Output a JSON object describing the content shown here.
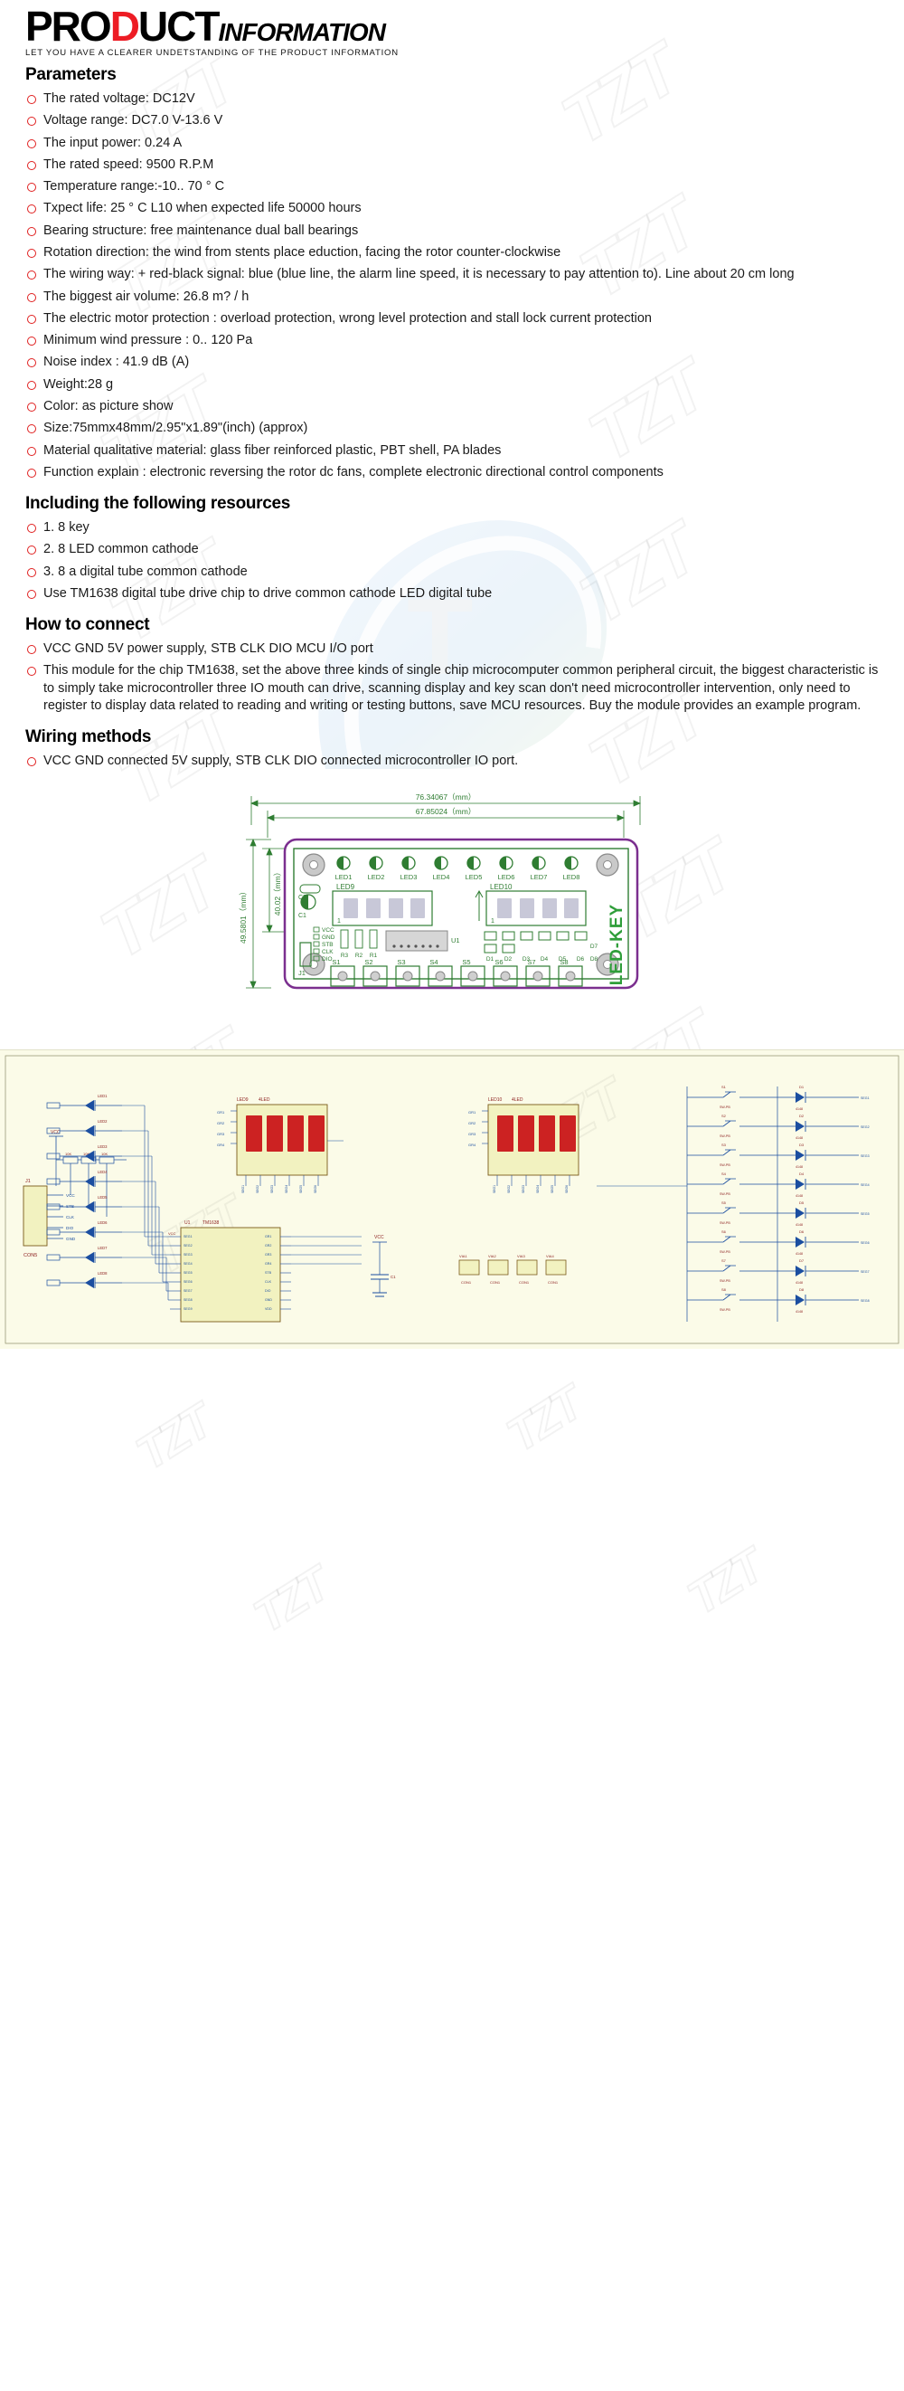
{
  "header": {
    "title_product": "PRODUCT",
    "title_pro": "PRO",
    "title_d": "D",
    "title_uct": "UCT",
    "title_information": "INFORMATION",
    "subtitle": "LET YOU HAVE A CLEARER UNDETSTANDING OF THE PRODUCT INFORMATION"
  },
  "watermark": {
    "text": "TZT"
  },
  "sections": {
    "parameters": {
      "heading": "Parameters",
      "items": [
        "The rated voltage: DC12V",
        "Voltage range: DC7.0 V-13.6 V",
        "The input power: 0.24 A",
        "The rated speed: 9500 R.P.M",
        "Temperature range:-10.. 70 ° C",
        "Txpect life: 25 ° C L10 when expected life 50000 hours",
        "Bearing structure: free maintenance dual ball bearings",
        "Rotation direction: the wind from stents place eduction, facing the rotor counter-clockwise",
        "The wiring way: + red-black signal: blue (blue line, the alarm line speed, it is necessary to pay attention to). Line about 20 cm long",
        "The biggest air volume: 26.8 m? / h",
        "The electric motor protection : overload protection, wrong level protection and stall lock current protection",
        "Minimum wind pressure : 0.. 120 Pa",
        "Noise index : 41.9 dB (A)",
        "Weight:28 g",
        "Color: as picture show",
        "Size:75mmx48mm/2.95\"x1.89\"(inch) (approx)",
        "Material qualitative material: glass fiber reinforced plastic, PBT shell, PA blades",
        "Function explain : electronic reversing the rotor dc fans, complete electronic directional control components"
      ]
    },
    "resources": {
      "heading": "Including the following resources",
      "items": [
        "1. 8 key",
        "2. 8 LED common cathode",
        "3. 8 a digital tube common cathode",
        "Use TM1638 digital tube drive chip to drive common cathode LED digital tube"
      ]
    },
    "how_to_connect": {
      "heading": "How to connect",
      "items": [
        "VCC GND 5V power supply, STB CLK DIO MCU I/O port",
        "This module for the chip TM1638, set the above three kinds of single chip microcomputer common peripheral circuit, the biggest characteristic is to simply take microcontroller three IO mouth can drive, scanning display and key scan don't need microcontroller intervention, only need to register to display data related to reading and writing or testing buttons, save MCU resources. Buy the module provides an example program."
      ]
    },
    "wiring_methods": {
      "heading": "Wiring methods",
      "items": [
        "VCC GND connected 5V supply, STB CLK DIO connected microcontroller IO port."
      ]
    }
  },
  "pcb_diagram": {
    "dimensions": {
      "width_outer": "76.34067（mm）",
      "width_inner": "67.85024（mm）",
      "height_inner": "40.02（mm）",
      "height_outer": "49.5801（mm）"
    },
    "board_brand": "LED-KEY",
    "led_row_labels": [
      "LED1",
      "LED2",
      "LED3",
      "LED4",
      "LED5",
      "LED6",
      "LED7",
      "LED8"
    ],
    "display_left_label": "LED9",
    "display_right_label": "LED10",
    "display_digit": "1",
    "switch_labels": [
      "S1",
      "S2",
      "S3",
      "S4",
      "S5",
      "S6",
      "S7",
      "S8"
    ],
    "diode_labels": [
      "D1",
      "D2",
      "D3",
      "D4",
      "D5",
      "D6",
      "D7",
      "D8"
    ],
    "pin_labels": [
      "VCC",
      "GND",
      "STB",
      "CLK",
      "DIO"
    ],
    "resistor_labels": [
      "R3",
      "R2",
      "R1"
    ],
    "chip_label": "U1",
    "connector_label": "J1",
    "cap_labels": [
      "C2",
      "C1"
    ]
  },
  "schematic": {
    "left_led_labels": [
      "LED1",
      "LED2",
      "LED3",
      "LED4",
      "LED5",
      "LED6",
      "LED7",
      "LED8"
    ],
    "left_resistor_labels": [
      "GR1",
      "GR2",
      "GR3",
      "GR4",
      "GR5",
      "GR6",
      "GR7",
      "GR8"
    ],
    "display_left_ref": "LED9",
    "display_left_type": "4LED",
    "display_right_ref": "LED10",
    "display_right_type": "4LED",
    "display_digits": "8.8.8.8.",
    "chip_ref": "U1",
    "chip_name": "TM1638",
    "connector_ref": "J1",
    "connector_name": "CON5",
    "connector_pins": [
      "VCC",
      "STB",
      "CLK",
      "DIO",
      "GND"
    ],
    "power_label": "VCC",
    "ground_label": "VCC",
    "cap_ref": "C1",
    "switch_labels": [
      "S1",
      "S2",
      "S3",
      "S4",
      "S5",
      "S6",
      "S7",
      "S8"
    ],
    "switch_type": "SW-PB",
    "diode_labels": [
      "D1",
      "D2",
      "D3",
      "D4",
      "D5",
      "D6",
      "D7",
      "D8"
    ],
    "diode_type": "4148",
    "seg_labels": [
      "SEG1",
      "SEG2",
      "SEG3",
      "SEG4",
      "SEG5",
      "SEG6",
      "SEG7",
      "SEG8"
    ],
    "grid_labels": [
      "GR1",
      "GR2",
      "GR3",
      "GR4"
    ],
    "via_refs": [
      "VIA1",
      "VIA2",
      "VIA3",
      "VIA4"
    ],
    "via_type": "CON1"
  }
}
